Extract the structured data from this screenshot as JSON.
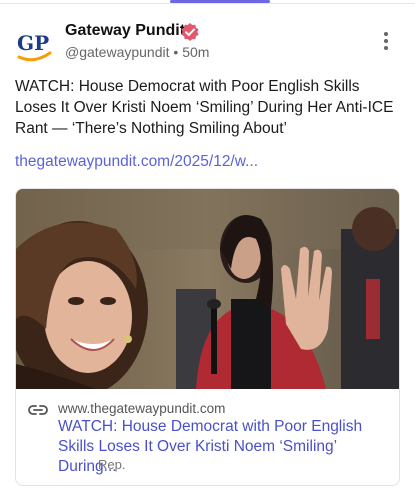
{
  "post": {
    "author_name": "Gateway Pundit",
    "handle": "@gatewaypundit",
    "separator": "•",
    "time_ago": "50m",
    "avatar_initials": "GP",
    "text": "WATCH: House Democrat with Poor English Skills Loses It Over Kristi Noem ‘Smiling’ During Her Anti-ICE Rant — ‘There’s Nothing Smiling About’",
    "link_text": "thegatewaypundit.com/2025/12/w...",
    "more_icon": "vertical-ellipsis-icon",
    "verified_icon": "verified-badge-icon"
  },
  "link_card": {
    "domain": "www.thegatewaypundit.com",
    "title": "WATCH: House Democrat with Poor English Skills Loses It Over Kristi Noem ‘Smiling’ During...",
    "source": "Rep.",
    "icon": "link-chain-icon"
  },
  "colors": {
    "accent": "#6d67e4",
    "link": "#5a63d8",
    "card_title": "#4a50c9",
    "verified": "#e05a6e",
    "avatar_blue": "#1e3a8a",
    "avatar_orange": "#f59e0b"
  }
}
